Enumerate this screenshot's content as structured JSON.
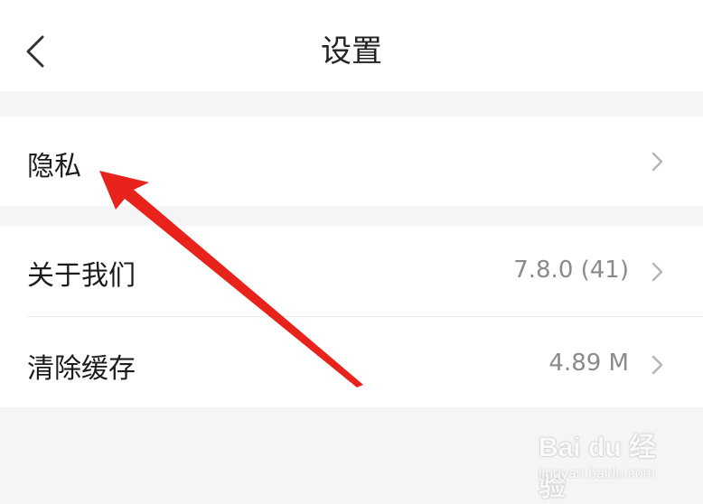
{
  "header": {
    "title": "设置",
    "back_icon": "chevron-left-icon"
  },
  "privacy_group": [
    {
      "label": "隐私",
      "value": ""
    }
  ],
  "info_group": [
    {
      "label": "关于我们",
      "value": "7.8.0 (41)"
    },
    {
      "label": "清除缓存",
      "value": "4.89 M"
    }
  ],
  "annotation": {
    "color": "#e8231c",
    "icon": "red-arrow"
  },
  "watermark": {
    "brand": "Bai du 经验",
    "url": "jingyan.baidu.com"
  },
  "colors": {
    "background": "#f5f5f5",
    "surface": "#ffffff",
    "secondary_text": "#8a8a8a"
  }
}
